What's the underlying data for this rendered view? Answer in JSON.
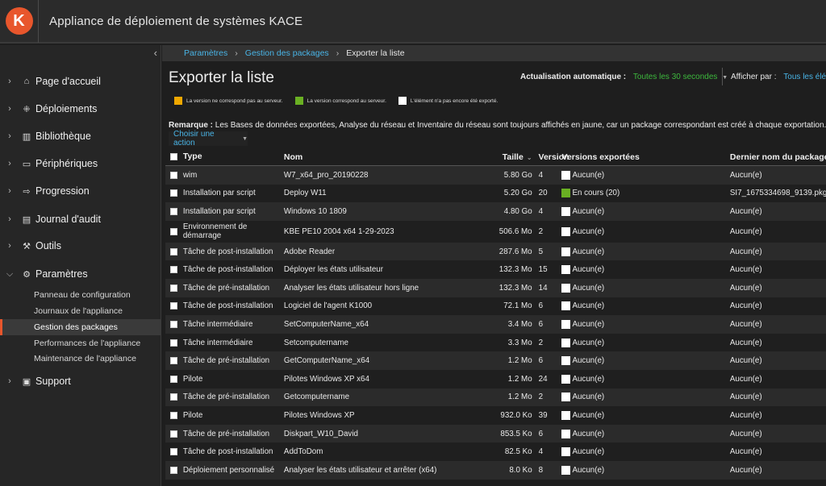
{
  "app": {
    "logo_letter": "K",
    "title": "Appliance de déploiement de systèmes KACE",
    "brand_color": "#e8562c"
  },
  "sidebar": {
    "collapse_glyph": "‹",
    "items": [
      {
        "label": "Page d'accueil",
        "icon": "home-icon",
        "expanded": false
      },
      {
        "label": "Déploiements",
        "icon": "deployments-icon",
        "expanded": false
      },
      {
        "label": "Bibliothèque",
        "icon": "library-icon",
        "expanded": false
      },
      {
        "label": "Périphériques",
        "icon": "devices-icon",
        "expanded": false
      },
      {
        "label": "Progression",
        "icon": "progress-icon",
        "expanded": false
      },
      {
        "label": "Journal d'audit",
        "icon": "audit-log-icon",
        "expanded": false
      },
      {
        "label": "Outils",
        "icon": "tools-icon",
        "expanded": false
      },
      {
        "label": "Paramètres",
        "icon": "settings-icon",
        "expanded": true
      },
      {
        "label": "Support",
        "icon": "support-icon",
        "expanded": false
      }
    ],
    "settings_sub": [
      {
        "label": "Panneau de configuration",
        "active": false
      },
      {
        "label": "Journaux de l'appliance",
        "active": false
      },
      {
        "label": "Gestion des packages",
        "active": true
      },
      {
        "label": "Performances de l'appliance",
        "active": false
      },
      {
        "label": "Maintenance de l'appliance",
        "active": false
      }
    ]
  },
  "breadcrumb": {
    "items": [
      "Paramètres",
      "Gestion des packages"
    ],
    "current": "Exporter la liste",
    "separator": "›"
  },
  "page": {
    "title": "Exporter la liste",
    "auto_refresh_label": "Actualisation automatique :",
    "auto_refresh_value": "Toutes les 30 secondes",
    "show_by_label": "Afficher par :",
    "show_by_value": "Tous les élé",
    "legend": [
      {
        "color": "#f0a800",
        "text": "La version ne correspond pas au serveur."
      },
      {
        "color": "#6ab023",
        "text": "La version correspond au serveur."
      },
      {
        "color": "#ffffff",
        "text": "L'élément n'a pas encore été exporté."
      }
    ],
    "remark_label": "Remarque :",
    "remark_text": " Les Bases de données exportées, Analyse du réseau et Inventaire du réseau sont toujours affichés en jaune, car un package correspondant est créé à chaque exportation.",
    "action_label": "Choisir une action",
    "action_caret": "▼"
  },
  "table": {
    "headers": {
      "type": "Type",
      "name": "Nom",
      "size": "Taille",
      "version": "Version",
      "exported": "Versions exportées",
      "last": "Dernier nom du package",
      "sort_glyph": "⌄"
    },
    "rows": [
      {
        "type": "wim",
        "name": "W7_x64_pro_20190228",
        "size": "5.80 Go",
        "version": "4",
        "exported": "Aucun(e)",
        "status_color": "#ffffff",
        "last": "Aucun(e)"
      },
      {
        "type": "Installation par script",
        "name": "Deploy W11",
        "size": "5.20 Go",
        "version": "20",
        "exported": "En cours (20)",
        "status_color": "#6ab023",
        "last": "SI7_1675334698_9139.pkg"
      },
      {
        "type": "Installation par script",
        "name": "Windows 10 1809",
        "size": "4.80 Go",
        "version": "4",
        "exported": "Aucun(e)",
        "status_color": "#ffffff",
        "last": "Aucun(e)"
      },
      {
        "type": "Environnement de démarrage",
        "name": "KBE PE10 2004 x64 1-29-2023",
        "size": "506.6 Mo",
        "version": "2",
        "exported": "Aucun(e)",
        "status_color": "#ffffff",
        "last": "Aucun(e)",
        "tall": true
      },
      {
        "type": "Tâche de post-installation",
        "name": "Adobe Reader",
        "size": "287.6 Mo",
        "version": "5",
        "exported": "Aucun(e)",
        "status_color": "#ffffff",
        "last": "Aucun(e)"
      },
      {
        "type": "Tâche de post-installation",
        "name": "Déployer les états utilisateur",
        "size": "132.3 Mo",
        "version": "15",
        "exported": "Aucun(e)",
        "status_color": "#ffffff",
        "last": "Aucun(e)"
      },
      {
        "type": "Tâche de pré-installation",
        "name": "Analyser les états utilisateur hors ligne",
        "size": "132.3 Mo",
        "version": "14",
        "exported": "Aucun(e)",
        "status_color": "#ffffff",
        "last": "Aucun(e)"
      },
      {
        "type": "Tâche de post-installation",
        "name": "Logiciel de l'agent K1000",
        "size": "72.1 Mo",
        "version": "6",
        "exported": "Aucun(e)",
        "status_color": "#ffffff",
        "last": "Aucun(e)"
      },
      {
        "type": "Tâche intermédiaire",
        "name": "SetComputerName_x64",
        "size": "3.4 Mo",
        "version": "6",
        "exported": "Aucun(e)",
        "status_color": "#ffffff",
        "last": "Aucun(e)"
      },
      {
        "type": "Tâche intermédiaire",
        "name": "Setcomputername",
        "size": "3.3 Mo",
        "version": "2",
        "exported": "Aucun(e)",
        "status_color": "#ffffff",
        "last": "Aucun(e)"
      },
      {
        "type": "Tâche de pré-installation",
        "name": "GetComputerName_x64",
        "size": "1.2 Mo",
        "version": "6",
        "exported": "Aucun(e)",
        "status_color": "#ffffff",
        "last": "Aucun(e)"
      },
      {
        "type": "Pilote",
        "name": "Pilotes Windows XP x64",
        "size": "1.2 Mo",
        "version": "24",
        "exported": "Aucun(e)",
        "status_color": "#ffffff",
        "last": "Aucun(e)"
      },
      {
        "type": "Tâche de pré-installation",
        "name": "Getcomputername",
        "size": "1.2 Mo",
        "version": "2",
        "exported": "Aucun(e)",
        "status_color": "#ffffff",
        "last": "Aucun(e)"
      },
      {
        "type": "Pilote",
        "name": "Pilotes Windows XP",
        "size": "932.0 Ko",
        "version": "39",
        "exported": "Aucun(e)",
        "status_color": "#ffffff",
        "last": "Aucun(e)"
      },
      {
        "type": "Tâche de pré-installation",
        "name": "Diskpart_W10_David",
        "size": "853.5 Ko",
        "version": "6",
        "exported": "Aucun(e)",
        "status_color": "#ffffff",
        "last": "Aucun(e)"
      },
      {
        "type": "Tâche de post-installation",
        "name": "AddToDom",
        "size": "82.5 Ko",
        "version": "4",
        "exported": "Aucun(e)",
        "status_color": "#ffffff",
        "last": "Aucun(e)"
      },
      {
        "type": "Déploiement personnalisé",
        "name": "Analyser les états utilisateur et arrêter (x64)",
        "size": "8.0 Ko",
        "version": "8",
        "exported": "Aucun(e)",
        "status_color": "#ffffff",
        "last": "Aucun(e)"
      }
    ]
  }
}
